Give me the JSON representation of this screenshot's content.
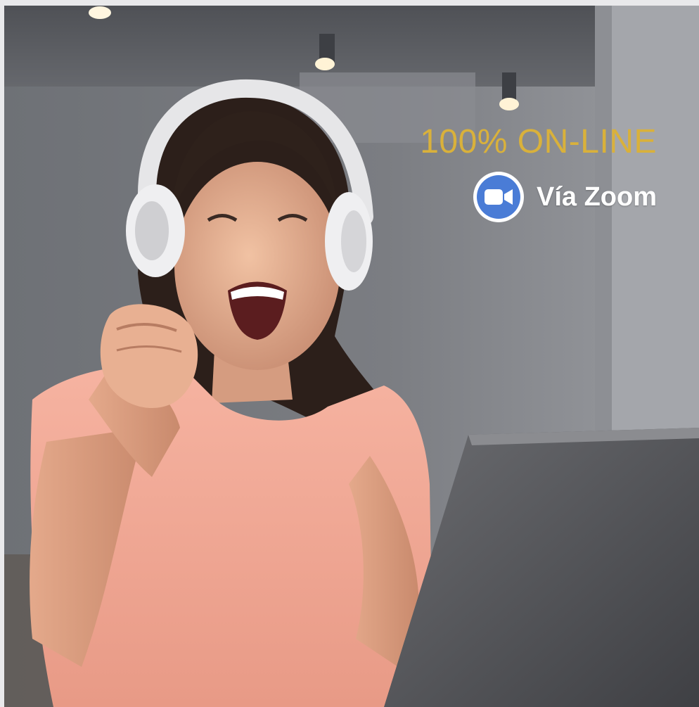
{
  "promo": {
    "headline": "100% ON-LINE",
    "zoom_label": "Vía Zoom"
  },
  "icons": {
    "video_camera": "video-camera-icon"
  },
  "colors": {
    "headline_gold": "#d9b13b",
    "zoom_blue": "#4a7cd6",
    "shirt_pink": "#f3aa98",
    "headphones": "#ececee"
  }
}
